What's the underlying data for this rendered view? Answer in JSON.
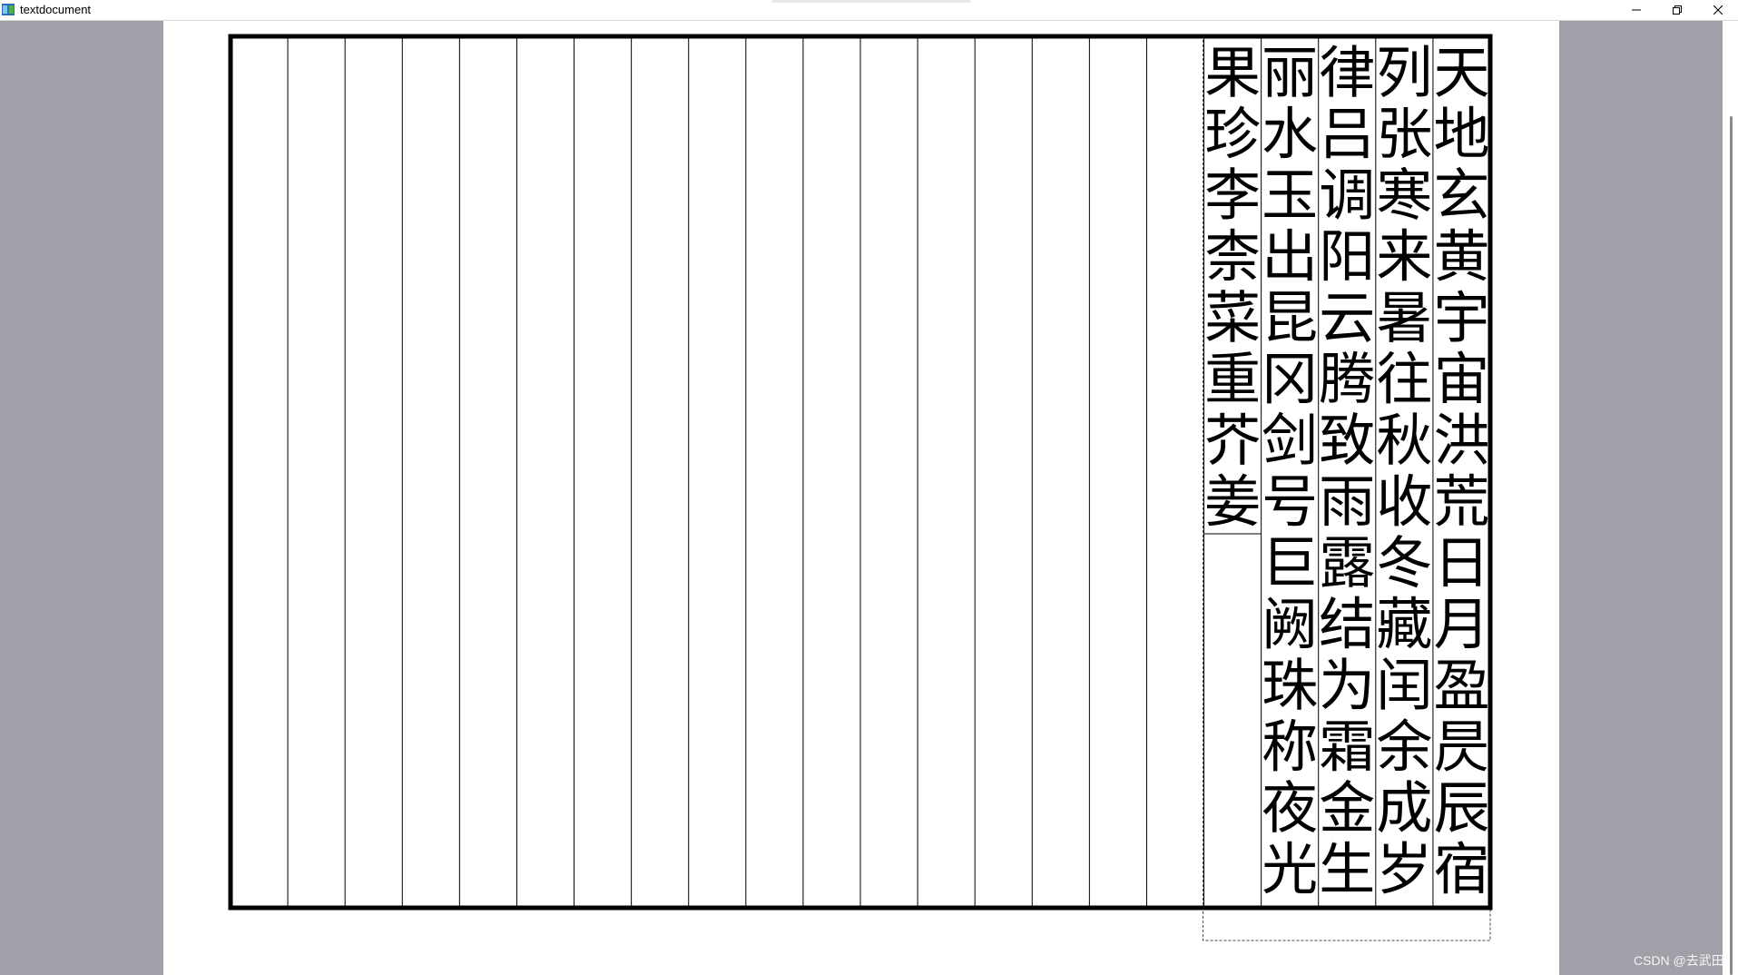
{
  "window": {
    "title": "textdocument"
  },
  "document": {
    "columns": [
      "天地玄黄宇宙洪荒日月盈昃辰宿",
      "列张寒来暑往秋收冬藏闰余成岁",
      "律吕调阳云腾致雨露结为霜金生",
      "丽水玉出昆冈剑号巨阙珠称夜光",
      "果珍李柰菜重芥姜"
    ]
  },
  "watermark": "CSDN @去武田",
  "colors": {
    "frame": "#000000",
    "background": "#a0a0a8",
    "page": "#ffffff"
  }
}
